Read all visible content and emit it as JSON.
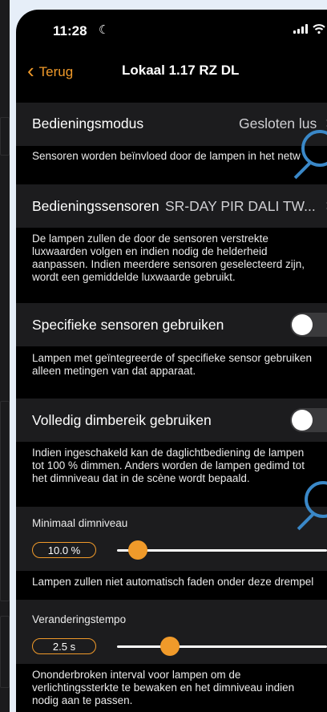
{
  "status_bar": {
    "time": "11:28",
    "moon": "☾"
  },
  "nav": {
    "back_label": "Terug",
    "title": "Lokaal 1.17 RZ DL"
  },
  "rows": {
    "mode": {
      "label": "Bedieningsmodus",
      "value": "Gesloten lus",
      "description": "Sensoren worden beïnvloed door de lampen in het netw"
    },
    "sensors": {
      "label": "Bedieningssensoren",
      "value": "SR-DAY PIR DALI TW...",
      "description": [
        "De lampen zullen de door de sensoren verstrekte",
        "luxwaarden volgen en indien nodig de helderheid",
        "aanpassen. Indien meerdere sensoren geselecteerd zijn,",
        "wordt een gemiddelde luxwaarde gebruikt."
      ]
    },
    "specific": {
      "label": "Specifieke sensoren gebruiken",
      "enabled": false,
      "description": [
        "Lampen met geïntegreerde of specifieke sensor gebruiken",
        "alleen metingen van dat apparaat."
      ]
    },
    "full_range": {
      "label": "Volledig dimbereik gebruiken",
      "enabled": false,
      "description": [
        "Indien ingeschakeld kan de daglichtbediening de lampen",
        "tot 100 % dimmen. Anders worden de lampen gedimd tot",
        "het dimniveau dat in de scène wordt bepaald."
      ]
    },
    "min_dim": {
      "label": "Minimaal dimniveau",
      "value": "10.0 %",
      "slider_fraction": 0.1,
      "description": "Lampen zullen niet automatisch faden onder deze drempel"
    },
    "rate": {
      "label": "Veranderingstempo",
      "value": "2.5 s",
      "slider_fraction": 0.25,
      "description": [
        "Ononderbroken interval voor lampen om de",
        "verlichtingssterkte te bewaken en het dimniveau indien",
        "nodig aan te passen."
      ]
    }
  },
  "colors": {
    "accent": "#f09a2a",
    "background": "#000000",
    "row": "#1c1c1e",
    "toggle_off": "#3a3a3c",
    "overlay": "#3a88c8"
  },
  "icons": [
    "back-chevron-icon",
    "moon-icon",
    "signal-icon",
    "wifi-icon",
    "battery-icon",
    "chevron-right-icon",
    "zoom-overlay-icon"
  ]
}
